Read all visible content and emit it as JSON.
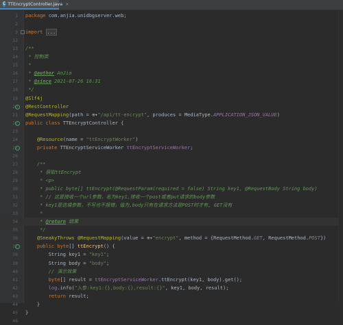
{
  "tab": {
    "label": "TTEncryptController.java",
    "icon": "java-class-icon"
  },
  "lines": [
    {
      "n": "1",
      "segs": [
        {
          "c": "kw",
          "t": "package "
        },
        {
          "c": "",
          "t": "com.anjia.unidbgserver.web;"
        }
      ]
    },
    {
      "n": "2",
      "segs": []
    },
    {
      "n": "3",
      "segs": [
        {
          "c": "kw",
          "t": "import "
        },
        {
          "c": "folded",
          "t": "..."
        }
      ],
      "fold": true
    },
    {
      "n": "12",
      "segs": []
    },
    {
      "n": "13",
      "segs": [
        {
          "c": "cmt",
          "t": "/**"
        }
      ]
    },
    {
      "n": "14",
      "segs": [
        {
          "c": "cmt",
          "t": " * 控制类"
        }
      ]
    },
    {
      "n": "15",
      "segs": [
        {
          "c": "cmt",
          "t": " *"
        }
      ]
    },
    {
      "n": "16",
      "segs": [
        {
          "c": "cmt",
          "t": " * "
        },
        {
          "c": "tag",
          "t": "@author"
        },
        {
          "c": "cmt",
          "t": " AnJia"
        }
      ]
    },
    {
      "n": "17",
      "segs": [
        {
          "c": "cmt",
          "t": " * "
        },
        {
          "c": "tag",
          "t": "@since"
        },
        {
          "c": "cmt",
          "t": " 2021-07-26 18:31"
        }
      ]
    },
    {
      "n": "18",
      "segs": [
        {
          "c": "cmt",
          "t": " */"
        }
      ]
    },
    {
      "n": "19",
      "segs": [
        {
          "c": "ann",
          "t": "@Slf4j"
        }
      ]
    },
    {
      "n": "20",
      "segs": [
        {
          "c": "ann",
          "t": "@RestController"
        }
      ],
      "bean": true
    },
    {
      "n": "21",
      "segs": [
        {
          "c": "ann",
          "t": "@RequestMapping"
        },
        {
          "c": "",
          "t": "(path = "
        },
        {
          "c": "",
          "t": "⊕▾"
        },
        {
          "c": "str",
          "t": "\"/api/tt-encrypt\""
        },
        {
          "c": "",
          "t": ", produces = MediaType."
        },
        {
          "c": "cst",
          "t": "APPLICATION_JSON_VALUE"
        },
        {
          "c": "",
          "t": ")"
        }
      ]
    },
    {
      "n": "22",
      "segs": [
        {
          "c": "kw",
          "t": "public class "
        },
        {
          "c": "",
          "t": "TTEncryptController {"
        }
      ],
      "bean": true
    },
    {
      "n": "23",
      "segs": []
    },
    {
      "n": "24",
      "segs": [
        {
          "c": "",
          "t": "    "
        },
        {
          "c": "ann",
          "t": "@Resource"
        },
        {
          "c": "",
          "t": "(name = "
        },
        {
          "c": "str",
          "t": "\"ttEncryptWorker\""
        },
        {
          "c": "",
          "t": ")"
        }
      ]
    },
    {
      "n": "25",
      "segs": [
        {
          "c": "",
          "t": "    "
        },
        {
          "c": "kw",
          "t": "private "
        },
        {
          "c": "",
          "t": "TTEncryptServiceWorker "
        },
        {
          "c": "fld",
          "t": "ttEncryptServiceWorker"
        },
        {
          "c": "",
          "t": ";"
        }
      ],
      "bean": true
    },
    {
      "n": "26",
      "segs": []
    },
    {
      "n": "27",
      "segs": [
        {
          "c": "",
          "t": "    "
        },
        {
          "c": "cmt",
          "t": "/**"
        }
      ]
    },
    {
      "n": "28",
      "segs": [
        {
          "c": "cmt",
          "t": "     * 获取ttEncrypt"
        }
      ]
    },
    {
      "n": "29",
      "segs": [
        {
          "c": "cmt",
          "t": "     * <p>"
        }
      ]
    },
    {
      "n": "30",
      "segs": [
        {
          "c": "cmt",
          "t": "     * public byte[] ttEncrypt(@RequestParam(required = false) String key1, @RequestBody String body)"
        }
      ]
    },
    {
      "n": "31",
      "segs": [
        {
          "c": "cmt",
          "t": "     * // 这是接收一个url参数，名为key1,接收一个post或者put请求的body参数"
        }
      ]
    },
    {
      "n": "32",
      "segs": [
        {
          "c": "cmt",
          "t": "     * key1是选填参数，不写也不报错，值为,body只有在请求方法是POST时才有, GET没有"
        }
      ]
    },
    {
      "n": "33",
      "segs": [
        {
          "c": "cmt",
          "t": "     *"
        }
      ]
    },
    {
      "n": "34",
      "segs": [
        {
          "c": "cmt",
          "t": "     * "
        },
        {
          "c": "tag",
          "t": "@return"
        },
        {
          "c": "cmt",
          "t": " 结果"
        }
      ],
      "current": true
    },
    {
      "n": "35",
      "segs": [
        {
          "c": "cmt",
          "t": "     */"
        }
      ]
    },
    {
      "n": "36",
      "segs": [
        {
          "c": "",
          "t": "    "
        },
        {
          "c": "ann",
          "t": "@SneakyThrows "
        },
        {
          "c": "ann",
          "t": "@RequestMapping"
        },
        {
          "c": "",
          "t": "(value = "
        },
        {
          "c": "",
          "t": "⊕▾"
        },
        {
          "c": "str",
          "t": "\"encrypt\""
        },
        {
          "c": "",
          "t": ", method = {RequestMethod."
        },
        {
          "c": "cst",
          "t": "GET"
        },
        {
          "c": "",
          "t": ", RequestMethod."
        },
        {
          "c": "cst",
          "t": "POST"
        },
        {
          "c": "",
          "t": "})"
        }
      ]
    },
    {
      "n": "37",
      "segs": [
        {
          "c": "",
          "t": "    "
        },
        {
          "c": "kw",
          "t": "public byte"
        },
        {
          "c": "",
          "t": "[] "
        },
        {
          "c": "mth",
          "t": "ttEncrypt"
        },
        {
          "c": "",
          "t": "() {"
        }
      ],
      "bean": true
    },
    {
      "n": "38",
      "segs": [
        {
          "c": "",
          "t": "        String key1 = "
        },
        {
          "c": "str",
          "t": "\"key1\""
        },
        {
          "c": "",
          "t": ";"
        }
      ]
    },
    {
      "n": "39",
      "segs": [
        {
          "c": "",
          "t": "        String body = "
        },
        {
          "c": "str",
          "t": "\"body\""
        },
        {
          "c": "",
          "t": ";"
        }
      ]
    },
    {
      "n": "40",
      "segs": [
        {
          "c": "",
          "t": "        "
        },
        {
          "c": "cmt",
          "t": "// 演示效果"
        }
      ]
    },
    {
      "n": "41",
      "segs": [
        {
          "c": "",
          "t": "        "
        },
        {
          "c": "kw",
          "t": "byte"
        },
        {
          "c": "",
          "t": "[] result = "
        },
        {
          "c": "fld",
          "t": "ttEncryptServiceWorker"
        },
        {
          "c": "",
          "t": ".ttEncrypt(key1, body).get();"
        }
      ]
    },
    {
      "n": "42",
      "segs": [
        {
          "c": "",
          "t": "        "
        },
        {
          "c": "fld",
          "t": "log"
        },
        {
          "c": "",
          "t": ".info("
        },
        {
          "c": "str",
          "t": "\"入参:key1:{},body:{},result:{}\""
        },
        {
          "c": "",
          "t": ", key1, body, result);"
        }
      ]
    },
    {
      "n": "43",
      "segs": [
        {
          "c": "",
          "t": "        "
        },
        {
          "c": "kw",
          "t": "return "
        },
        {
          "c": "",
          "t": "result;"
        }
      ]
    },
    {
      "n": "44",
      "segs": [
        {
          "c": "",
          "t": "    }"
        }
      ]
    },
    {
      "n": "45",
      "segs": [
        {
          "c": "",
          "t": "}"
        }
      ]
    },
    {
      "n": "46",
      "segs": []
    }
  ]
}
